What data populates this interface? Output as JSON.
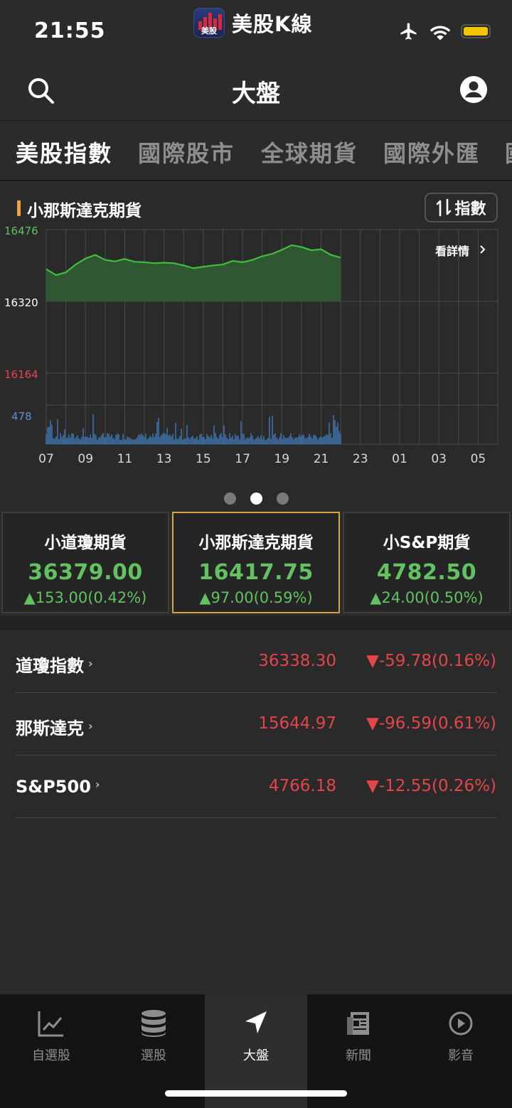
{
  "status_bar": {
    "time": "21:55",
    "app_name": "美股K線",
    "app_logo_text": "美股"
  },
  "header": {
    "title": "大盤"
  },
  "category_tabs": [
    "美股指數",
    "國際股市",
    "全球期貨",
    "國際外匯",
    "國"
  ],
  "chart": {
    "title": "小那斯達克期貨",
    "toggle_label": "指數",
    "detail_link": "看詳情",
    "colors": {
      "price_line": "#3cbf3c",
      "price_fill": "#2f5a31",
      "volume": "#3f74b0",
      "grid": "#4a4a4a"
    }
  },
  "chart_data": {
    "type": "area",
    "title": "小那斯達克期貨",
    "y_ticks": [
      "16476",
      "16320",
      "16164"
    ],
    "ylim": [
      16164,
      16476
    ],
    "volume_max_label": "478",
    "x_ticks": [
      "07",
      "09",
      "11",
      "13",
      "15",
      "17",
      "19",
      "21",
      "23",
      "01",
      "03",
      "05"
    ],
    "base_line": 16320,
    "series": [
      {
        "name": "price",
        "x_hours": [
          7,
          7.5,
          8,
          8.5,
          9,
          9.5,
          10,
          10.5,
          11,
          11.5,
          12,
          12.5,
          13,
          13.5,
          14,
          14.5,
          15,
          15.5,
          16,
          16.5,
          17,
          17.5,
          18,
          18.5,
          19,
          19.5,
          20,
          20.5,
          21,
          21.5,
          22
        ],
        "values": [
          16390,
          16377,
          16383,
          16400,
          16413,
          16421,
          16410,
          16407,
          16412,
          16406,
          16405,
          16403,
          16404,
          16403,
          16398,
          16392,
          16395,
          16398,
          16400,
          16408,
          16405,
          16410,
          16418,
          16423,
          16432,
          16442,
          16438,
          16431,
          16433,
          16421,
          16415
        ]
      }
    ],
    "grid": true
  },
  "page_dots": {
    "count": 3,
    "active_index": 1
  },
  "futures_cards": [
    {
      "name": "小道瓊期貨",
      "price": "36379.00",
      "change": "▲153.00(0.42%)"
    },
    {
      "name": "小那斯達克期貨",
      "price": "16417.75",
      "change": "▲97.00(0.59%)"
    },
    {
      "name": "小S&P期貨",
      "price": "4782.50",
      "change": "▲24.00(0.50%)"
    }
  ],
  "indices": [
    {
      "name": "道瓊指數",
      "value": "36338.30",
      "change": "▼-59.78(0.16%)"
    },
    {
      "name": "那斯達克",
      "value": "15644.97",
      "change": "▼-96.59(0.61%)"
    },
    {
      "name": "S&P500",
      "value": "4766.18",
      "change": "▼-12.55(0.26%)"
    }
  ],
  "bottom_nav": [
    {
      "label": "自選股",
      "icon": "chart-trend-icon"
    },
    {
      "label": "選股",
      "icon": "database-stack-icon"
    },
    {
      "label": "大盤",
      "icon": "location-arrow-icon"
    },
    {
      "label": "新聞",
      "icon": "newspaper-icon"
    },
    {
      "label": "影音",
      "icon": "play-circle-icon"
    }
  ]
}
